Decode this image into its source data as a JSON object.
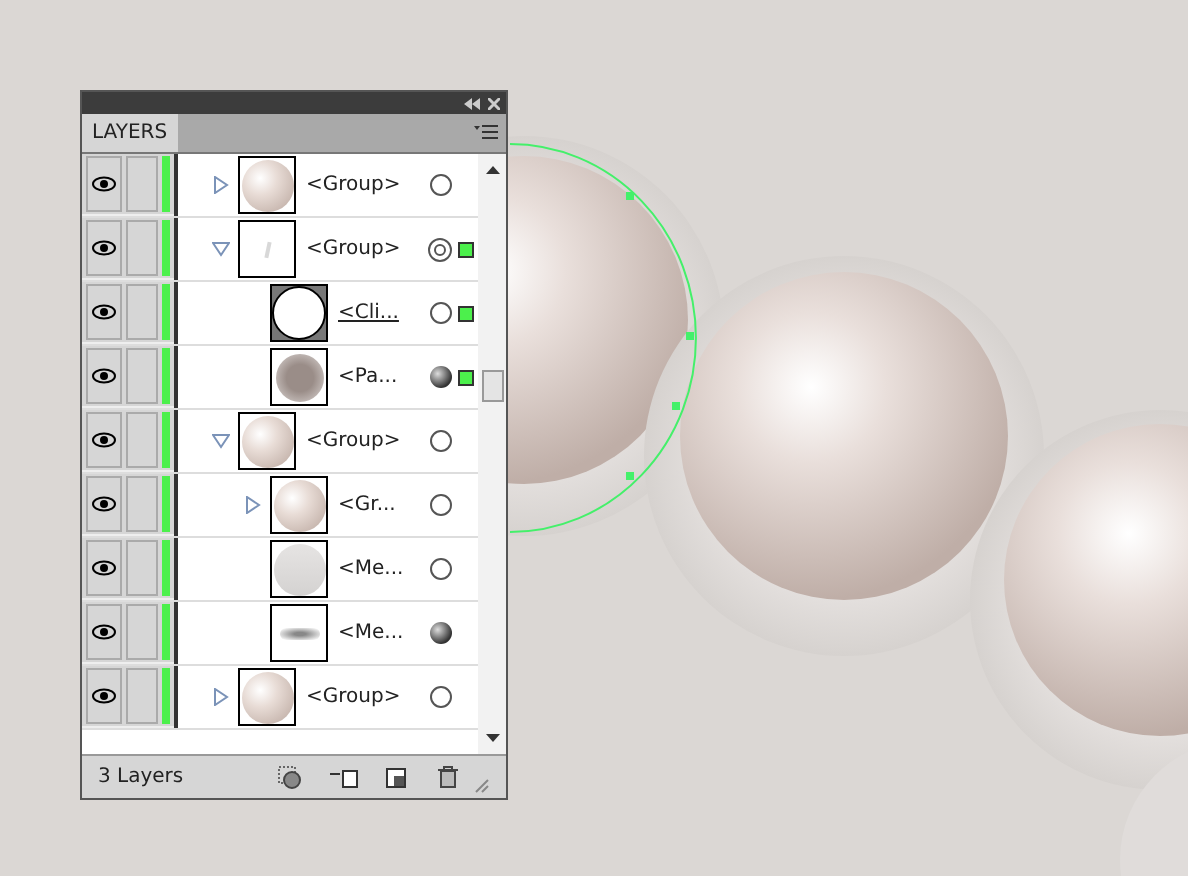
{
  "panel": {
    "tab": {
      "label": "LAYERS",
      "selected": true
    },
    "items": [
      {
        "name": "<Group>",
        "kind": "pearl",
        "visible": true,
        "expanded": false,
        "targeted": false,
        "filled": false,
        "selected": false
      },
      {
        "name": "<Group>",
        "kind": "blank",
        "visible": true,
        "expanded": true,
        "targeted": true,
        "filled": false,
        "selected": true,
        "children": [
          {
            "name": "<Cli...",
            "kind": "clip",
            "visible": true,
            "targeted": false,
            "filled": false,
            "selected": true,
            "underlined": true
          },
          {
            "name": "<Pa...",
            "kind": "blur",
            "visible": true,
            "targeted": false,
            "filled": true,
            "selected": true,
            "underlined": false
          }
        ]
      },
      {
        "name": "<Group>",
        "kind": "pearl",
        "visible": true,
        "expanded": true,
        "targeted": false,
        "filled": false,
        "selected": false,
        "children": [
          {
            "name": "<Gr...",
            "kind": "pearl",
            "visible": true,
            "expanded": false,
            "targeted": false,
            "filled": false,
            "selected": false,
            "underlined": false
          },
          {
            "name": "<Me...",
            "kind": "mesh",
            "visible": true,
            "targeted": false,
            "filled": false,
            "selected": false,
            "underlined": false
          },
          {
            "name": "<Me...",
            "kind": "shadow",
            "visible": true,
            "targeted": false,
            "filled": true,
            "selected": false,
            "underlined": false
          }
        ]
      },
      {
        "name": "<Group>",
        "kind": "pearl",
        "visible": true,
        "expanded": false,
        "targeted": false,
        "filled": false,
        "selected": false
      }
    ],
    "status": "3 Layers"
  }
}
